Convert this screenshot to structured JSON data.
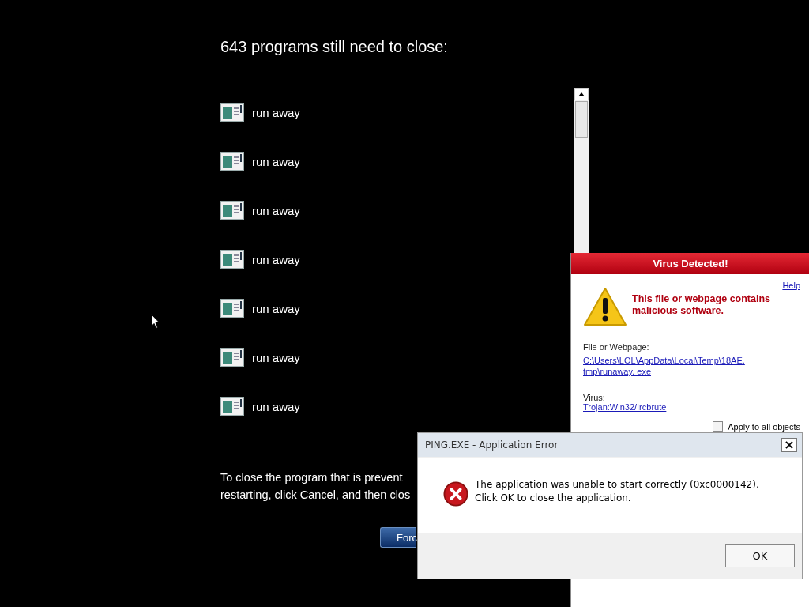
{
  "shutdown": {
    "heading": "643 programs still need to close:",
    "programs": [
      {
        "name": "run away"
      },
      {
        "name": "run away"
      },
      {
        "name": "run away"
      },
      {
        "name": "run away"
      },
      {
        "name": "run away"
      },
      {
        "name": "run away"
      },
      {
        "name": "run away"
      }
    ],
    "message_lines": [
      "To close the program that is prevent",
      "restarting, click Cancel, and then clos"
    ],
    "button": "Forc"
  },
  "virus_dialog": {
    "title": "Virus Detected!",
    "help": "Help",
    "warning": "This file or webpage contains malicious software.",
    "file_label": "File or Webpage:",
    "file_path": "C:\\Users\\LOL\\AppData\\Local\\Temp\\18AE. tmp\\runaway. exe",
    "virus_label": "Virus:",
    "virus_name": "Trojan:Win32/Ircbrute",
    "apply_all": {
      "label": "Apply to all objects",
      "checked": false
    }
  },
  "error_dialog": {
    "title": "PING.EXE - Application Error",
    "close": "×",
    "message": "The application was unable to start correctly (0xc0000142). Click OK to close the application.",
    "button": "OK"
  }
}
